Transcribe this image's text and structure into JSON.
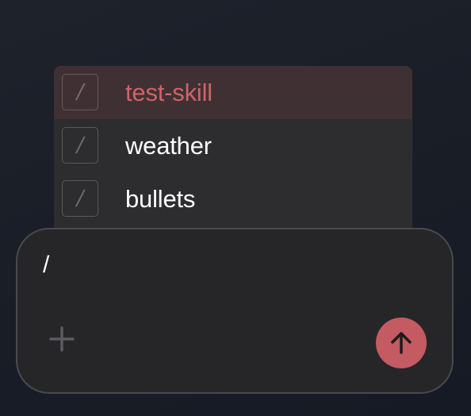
{
  "slash_menu": {
    "items": [
      {
        "icon": "slash-icon",
        "glyph": "/",
        "label": "test-skill",
        "active": true
      },
      {
        "icon": "slash-icon",
        "glyph": "/",
        "label": "weather",
        "active": false
      },
      {
        "icon": "slash-icon",
        "glyph": "/",
        "label": "bullets",
        "active": false
      }
    ]
  },
  "composer": {
    "value": "/",
    "add_icon": "plus-icon",
    "send_icon": "arrow-up-icon"
  },
  "colors": {
    "accent": "#c45a62",
    "active_label": "#d0626a",
    "active_row_bg": "#3f3133",
    "menu_bg": "#2d2d2f",
    "composer_bg": "#262629"
  }
}
